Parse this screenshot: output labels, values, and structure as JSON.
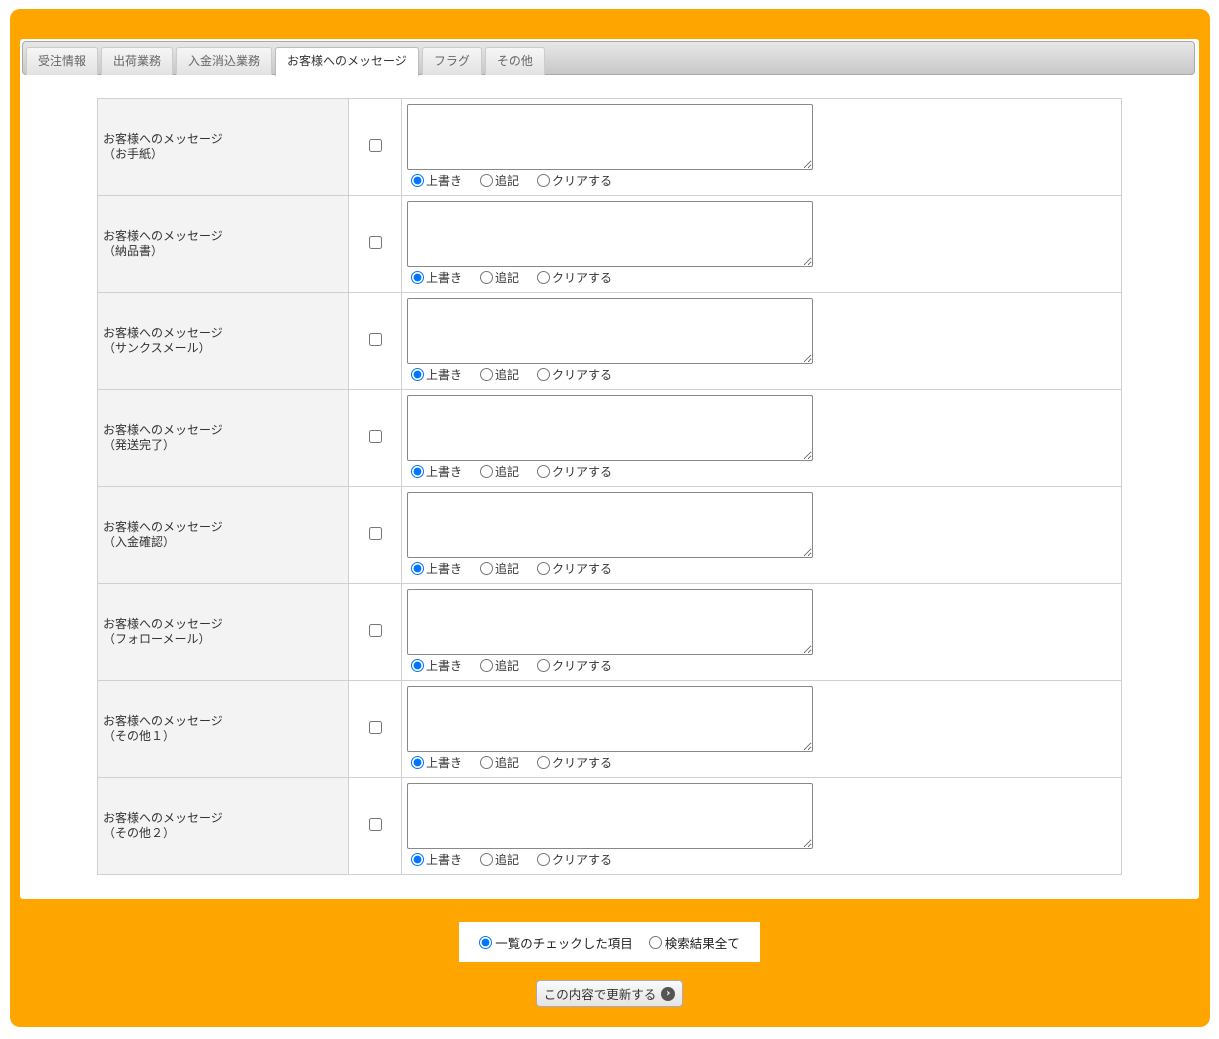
{
  "tabs": [
    {
      "label": "受注情報",
      "active": false
    },
    {
      "label": "出荷業務",
      "active": false
    },
    {
      "label": "入金消込業務",
      "active": false
    },
    {
      "label": "お客様へのメッセージ",
      "active": true
    },
    {
      "label": "フラグ",
      "active": false
    },
    {
      "label": "その他",
      "active": false
    }
  ],
  "mode_options": [
    "上書き",
    "追記",
    "クリアする"
  ],
  "rows": [
    {
      "title": "お客様へのメッセージ",
      "sub": "（お手紙）",
      "checked": false,
      "value": "",
      "mode": 0
    },
    {
      "title": "お客様へのメッセージ",
      "sub": "（納品書）",
      "checked": false,
      "value": "",
      "mode": 0
    },
    {
      "title": "お客様へのメッセージ",
      "sub": "（サンクスメール）",
      "checked": false,
      "value": "",
      "mode": 0
    },
    {
      "title": "お客様へのメッセージ",
      "sub": "（発送完了）",
      "checked": false,
      "value": "",
      "mode": 0
    },
    {
      "title": "お客様へのメッセージ",
      "sub": "（入金確認）",
      "checked": false,
      "value": "",
      "mode": 0
    },
    {
      "title": "お客様へのメッセージ",
      "sub": "（フォローメール）",
      "checked": false,
      "value": "",
      "mode": 0
    },
    {
      "title": "お客様へのメッセージ",
      "sub": "（その他１）",
      "checked": false,
      "value": "",
      "mode": 0
    },
    {
      "title": "お客様へのメッセージ",
      "sub": "（その他２）",
      "checked": false,
      "value": "",
      "mode": 0
    }
  ],
  "scope": {
    "options": [
      "一覧のチェックした項目",
      "検索結果全て"
    ],
    "selected": 0
  },
  "submit_label": "この内容で更新する",
  "colors": {
    "frame": "#ffa500",
    "label_bg": "#f2f3f2"
  }
}
